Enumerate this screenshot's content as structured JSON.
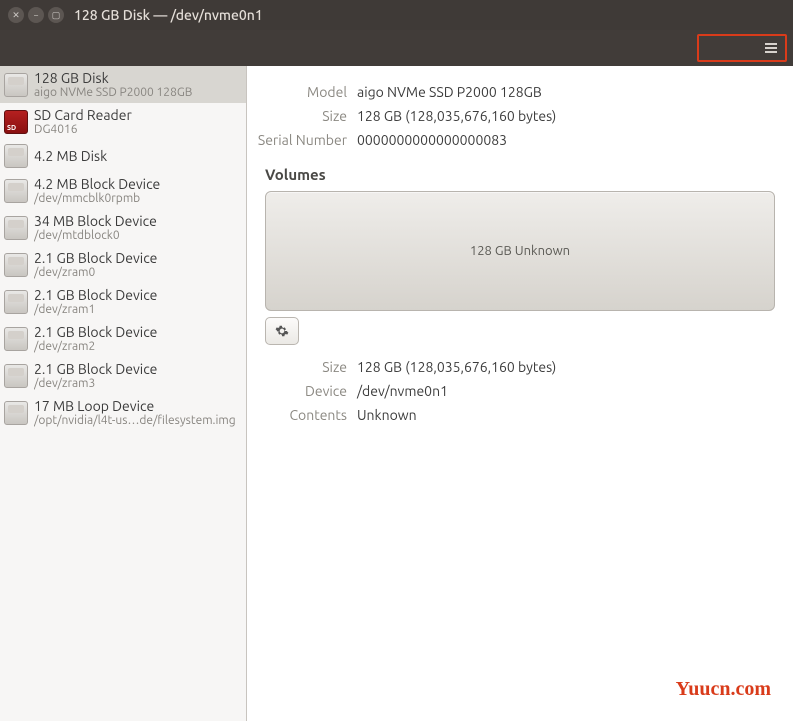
{
  "window": {
    "title": "128 GB Disk — /dev/nvme0n1"
  },
  "sidebar": {
    "devices": [
      {
        "name": "128 GB Disk",
        "sub": "aigo NVMe SSD P2000 128GB",
        "icon": "disk",
        "selected": true
      },
      {
        "name": "SD Card Reader",
        "sub": "DG4016",
        "icon": "sd",
        "selected": false
      },
      {
        "name": "4.2 MB Disk",
        "sub": "",
        "icon": "disk",
        "selected": false
      },
      {
        "name": "4.2 MB Block Device",
        "sub": "/dev/mmcblk0rpmb",
        "icon": "disk",
        "selected": false
      },
      {
        "name": "34 MB Block Device",
        "sub": "/dev/mtdblock0",
        "icon": "disk",
        "selected": false
      },
      {
        "name": "2.1 GB Block Device",
        "sub": "/dev/zram0",
        "icon": "disk",
        "selected": false
      },
      {
        "name": "2.1 GB Block Device",
        "sub": "/dev/zram1",
        "icon": "disk",
        "selected": false
      },
      {
        "name": "2.1 GB Block Device",
        "sub": "/dev/zram2",
        "icon": "disk",
        "selected": false
      },
      {
        "name": "2.1 GB Block Device",
        "sub": "/dev/zram3",
        "icon": "disk",
        "selected": false
      },
      {
        "name": "17 MB Loop Device",
        "sub": "/opt/nvidia/l4t-us…de/filesystem.img",
        "icon": "disk",
        "selected": false
      }
    ]
  },
  "details": {
    "model_label": "Model",
    "model_value": "aigo NVMe SSD P2000 128GB",
    "size_label": "Size",
    "size_value": "128 GB (128,035,676,160 bytes)",
    "serial_label": "Serial Number",
    "serial_value": "0000000000000000083"
  },
  "volumes": {
    "header": "Volumes",
    "partition_label": "128 GB Unknown",
    "size_label": "Size",
    "size_value": "128 GB (128,035,676,160 bytes)",
    "device_label": "Device",
    "device_value": "/dev/nvme0n1",
    "contents_label": "Contents",
    "contents_value": "Unknown"
  },
  "watermark": "Yuucn.com"
}
